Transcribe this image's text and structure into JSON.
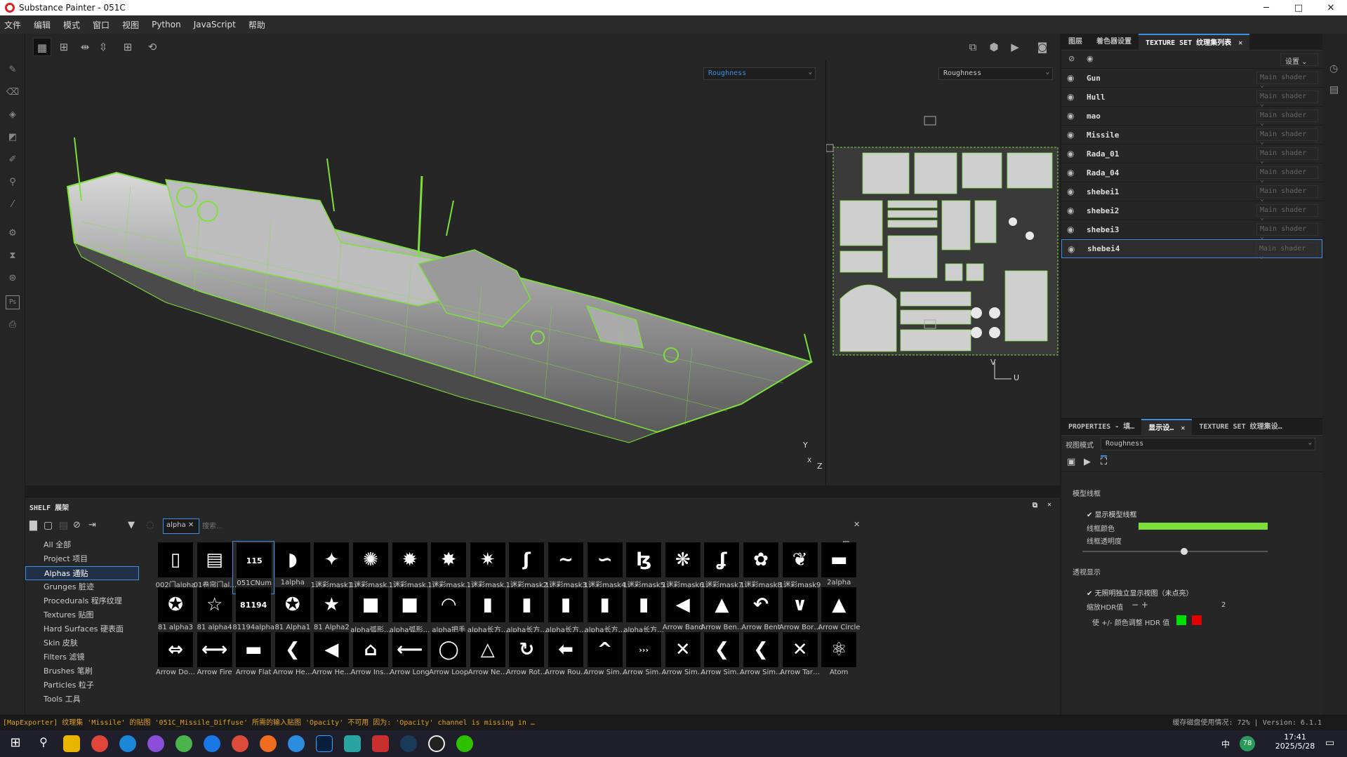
{
  "window": {
    "title": "Substance Painter - 051C",
    "minimize": "─",
    "maximize": "□",
    "close": "✕"
  },
  "menu": [
    "文件",
    "编辑",
    "模式",
    "窗口",
    "视图",
    "Python",
    "JavaScript",
    "帮助"
  ],
  "viewport": {
    "channel_3d": "Roughness",
    "channel_2d": "Roughness",
    "axis_y": "Y",
    "axis_z": "Z",
    "axis_x": "X",
    "axis_v": "V",
    "axis_u": "U"
  },
  "right_tabs": [
    {
      "label": "图层"
    },
    {
      "label": "着色器设置"
    },
    {
      "label": "TEXTURE SET 纹理集列表",
      "close": "✕"
    }
  ],
  "texture_sets": {
    "settings_label": "设置",
    "shader_placeholder": "Main shader",
    "items": [
      "Gun",
      "Hull",
      "mao",
      "Missile",
      "Rada_01",
      "Rada_04",
      "shebei1",
      "shebei2",
      "shebei3",
      "shebei4"
    ],
    "selected": "shebei4"
  },
  "props_tabs": [
    {
      "label": "PROPERTIES - 填…"
    },
    {
      "label": "显示设…",
      "close": "✕"
    },
    {
      "label": "TEXTURE SET 纹理集设…"
    }
  ],
  "display": {
    "view_mode_label": "视图模式",
    "view_mode_value": "Roughness",
    "wireframe_section": "模型线框",
    "show_wireframe": "显示模型线框",
    "wire_color_label": "线框颜色",
    "wire_color": "#7de03a",
    "wire_opacity_label": "线框透明度",
    "wire_opacity": 0.55,
    "transparency_section": "透视显示",
    "independent_view": "无照明独立显示视图（未点亮）",
    "hdr_label": "缩放HDR值",
    "hdr_value": "2",
    "hdr_adjust": "使 +/- 颜色调整 HDR 值"
  },
  "shelf": {
    "title": "SHELF 展架",
    "filter_tag": "alpha",
    "search_placeholder": "搜索...",
    "categories": [
      "All 全部",
      "Project 项目",
      "Alphas 通贴",
      "Grunges 脏迹",
      "Procedurals 程序纹理",
      "Textures 贴图",
      "Hard Surfaces 硬表面",
      "Skin 皮肤",
      "Filters 滤镜",
      "Brushes 笔刷",
      "Particles 粒子",
      "Tools 工具"
    ],
    "selected_category": "Alphas 通贴",
    "rows": [
      [
        "002门alpha",
        "01卷帘门al…",
        "051CNum",
        "1alpha",
        "1迷彩mask1",
        "1迷彩mask…",
        "1迷彩mask…",
        "1迷彩mask…",
        "1迷彩mask…",
        "1迷彩mask2",
        "1迷彩mask3",
        "1迷彩mask4",
        "1迷彩mask5",
        "1迷彩mask6",
        "1迷彩mask7",
        "1迷彩mask8",
        "1迷彩mask9",
        "2alpha"
      ],
      [
        "81 alpha3",
        "81 alpha4",
        "81194alpha",
        "81 Alpha1",
        "81 Alpha2",
        "alpha弧形…",
        "alpha弧形…",
        "alpha把手",
        "alpha长方…",
        "alpha长方…",
        "alpha长方…",
        "alpha长方…",
        "alpha长方…",
        "Arrow Band",
        "Arrow Ben…",
        "Arrow Bent",
        "Arrow Bor…",
        "Arrow Circle"
      ],
      [
        "Arrow Do…",
        "Arrow Fire",
        "Arrow Flat",
        "Arrow He…",
        "Arrow He…",
        "Arrow Ins…",
        "Arrow Long",
        "Arrow Loop",
        "Arrow Ne…",
        "Arrow Rot…",
        "Arrow Rou…",
        "Arrow Sim…",
        "Arrow Sim…",
        "Arrow Sim…",
        "Arrow Sim…",
        "Arrow Sim…",
        "Arrow Tar…",
        "Atom"
      ]
    ],
    "glyphs": [
      [
        "▯",
        "▤",
        "115",
        "◗",
        "✦",
        "✺",
        "✹",
        "✸",
        "✷",
        "ʃ",
        "∼",
        "∽",
        "ɮ",
        "❋",
        "ʆ",
        "✿",
        "❦",
        "▬"
      ],
      [
        "✪",
        "☆",
        "81194",
        "✪",
        "★",
        "■",
        "■",
        "◠",
        "▮",
        "▮",
        "▮",
        "▮",
        "▮",
        "◀",
        "▲",
        "↶",
        "∨",
        "▲"
      ],
      [
        "⇔",
        "⟷",
        "▬",
        "❮",
        "◀",
        "⌂",
        "⟵",
        "◯",
        "△",
        "↻",
        "⬅",
        "^",
        "›››",
        "✕",
        "❮",
        "❮",
        "✕",
        "⚛"
      ]
    ]
  },
  "status": {
    "message": "[MapExporter] 纹理集 'Missile' 的贴图 '051C_Missile_Diffuse' 所需的输入贴图 'Opacity' 不可用 因为: 'Opacity' channel is missing in …",
    "cache": "缓存磁盘使用情况: 72% | Version: 6.1.1"
  },
  "taskbar": {
    "time": "17:41",
    "date": "2025/5/28",
    "ime": "中",
    "battery": "78"
  }
}
